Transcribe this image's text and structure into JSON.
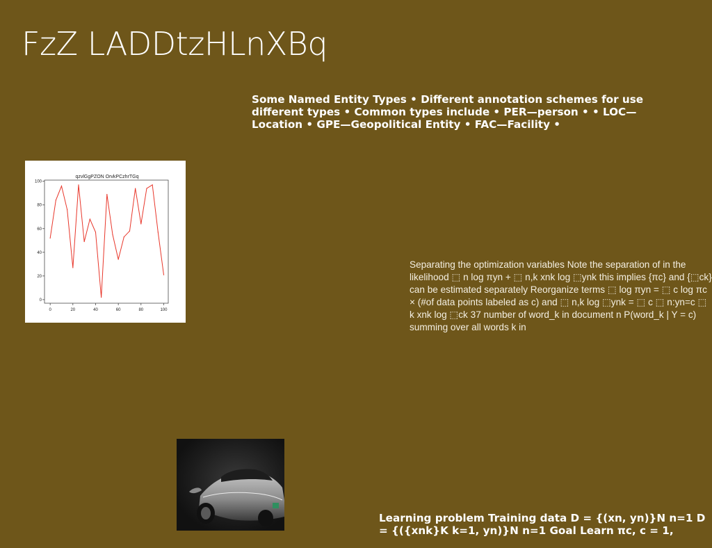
{
  "slide": {
    "title": "FzZ LADDtzHLnXBq",
    "entity_types_text": "Some Named Entity Types • Different annotation schemes for use different types • Common types include • PER—person • • LOC—Location • GPE—Geopolitical Entity • FAC—Facility •",
    "optimization_text": "Separating the optimization variables Note the separation of in the likelihood ⬚ n log πyn + ⬚ n,k xnk log ⬚ynk this implies {πc} and {⬚ck} can be estimated separately Reorganize terms ⬚ log πyn = ⬚ c log πc × (#of data points labeled as c) and ⬚ n,k log ⬚ynk = ⬚ c ⬚ n:yn=c ⬚ k xnk log ⬚ck 37 number of word_k in document n P(word_k | Y = c) summing over all words k in",
    "learning_text": "Learning problem Training data D = {(xn, yn)}N n=1 D = {({xnk}K k=1, yn)}N n=1 Goal Learn πc, c = 1,"
  },
  "chart_data": {
    "type": "line",
    "title": "qzvlGgPZON OrvkPCzhrTGq",
    "x": [
      0,
      5,
      10,
      15,
      20,
      25,
      30,
      35,
      40,
      45,
      50,
      55,
      60,
      65,
      70,
      75,
      80,
      85,
      90,
      95,
      100
    ],
    "series": [
      {
        "color": "#e8362a",
        "values": [
          52,
          84,
          96,
          76,
          27,
          97,
          49,
          68,
          57,
          2,
          89,
          55,
          34,
          53,
          58,
          94,
          64,
          94,
          97,
          57,
          21
        ]
      }
    ],
    "xticks": [
      0,
      20,
      40,
      60,
      80,
      100
    ],
    "yticks": [
      0,
      20,
      40,
      60,
      80,
      100
    ],
    "xlim": [
      -5,
      104
    ],
    "ylim": [
      -3,
      101
    ],
    "grid": false
  },
  "colors": {
    "background": "#6e561a",
    "text": "#ffffff",
    "line": "#e8362a"
  }
}
